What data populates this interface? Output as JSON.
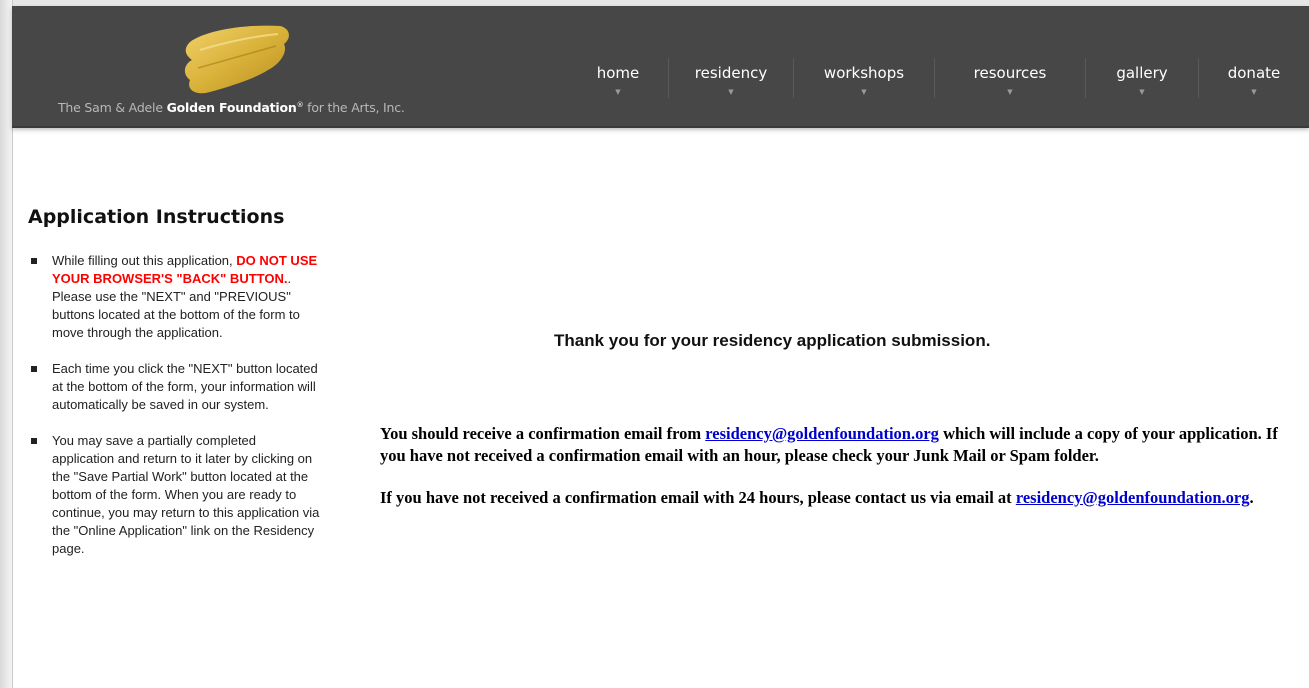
{
  "header": {
    "logo": {
      "prefix": "The Sam & Adele ",
      "strong": "Golden Foundation",
      "tm": "®",
      "suffix": " for the Arts, Inc.",
      "swash_color": "#d9b23a"
    },
    "nav": [
      {
        "label": "home",
        "arrow": "▼"
      },
      {
        "label": "residency",
        "arrow": "▼"
      },
      {
        "label": "workshops",
        "arrow": "▼"
      },
      {
        "label": "resources",
        "arrow": "▼"
      },
      {
        "label": "gallery",
        "arrow": "▼"
      },
      {
        "label": "donate",
        "arrow": "▼"
      }
    ]
  },
  "sidebar": {
    "title": "Application Instructions",
    "items": [
      {
        "pre": "While filling out this application, ",
        "warn": "DO NOT USE YOUR BROWSER'S \"BACK\" BUTTON.",
        "post": ". Please use the \"NEXT\" and \"PREVIOUS\" buttons located at the bottom of the form to move through the application."
      },
      {
        "text": "Each time you click the \"NEXT\" button located at the bottom of the form, your information will automatically be saved in our system."
      },
      {
        "text": "You may save a partially completed application and return to it later by clicking on the \"Save Partial Work\" button located at the bottom of the form. When you are ready to continue, you may return to this application via the \"Online Application\" link on the Residency page."
      }
    ]
  },
  "main": {
    "heading": "Thank you for your residency application submission.",
    "para1_pre": "You should receive a confirmation email from ",
    "email": "residency@goldenfoundation.org",
    "para1_post": " which will include a copy of your application. If you have not received a confirmation email with an hour, please check your Junk Mail or Spam folder.",
    "para2_pre": "If you have not received a confirmation email with 24 hours, please contact us via email at ",
    "para2_post": ".",
    "link_color": "#0000cc",
    "warn_color": "#ff0000"
  }
}
